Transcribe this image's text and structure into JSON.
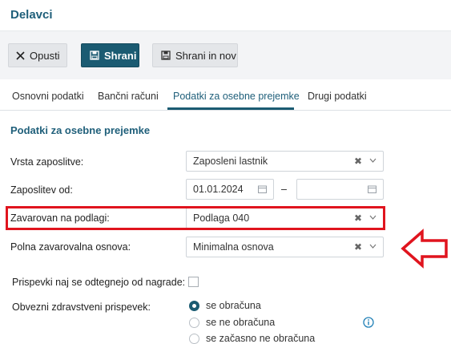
{
  "header": {
    "title": "Delavci"
  },
  "toolbar": {
    "cancel_label": "Opusti",
    "save_label": "Shrani",
    "save_new_label": "Shrani in nov"
  },
  "tabs": [
    {
      "label": "Osnovni podatki"
    },
    {
      "label": "Bančni računi"
    },
    {
      "label": "Podatki za osebne prejemke"
    },
    {
      "label": "Drugi podatki"
    }
  ],
  "section": {
    "title": "Podatki za osebne prejemke"
  },
  "form": {
    "employment_type": {
      "label": "Vrsta zaposlitve:",
      "value": "Zaposleni lastnik"
    },
    "employment_from": {
      "label": "Zaposlitev od:",
      "from": "01.01.2024",
      "separator": "–",
      "to": ""
    },
    "insured_basis": {
      "label": "Zavarovan na podlagi:",
      "value": "Podlaga 040"
    },
    "full_insurance_basis": {
      "label": "Polna zavarovalna osnova:",
      "value": "Minimalna osnova"
    },
    "deduct_contributions": {
      "label": "Prispevki naj se odtegnejo od nagrade:",
      "checked": false
    },
    "health_contribution": {
      "label": "Obvezni zdravstveni prispevek:",
      "options": [
        {
          "label": "se obračuna",
          "selected": true
        },
        {
          "label": "se ne obračuna",
          "selected": false
        },
        {
          "label": "se začasno ne obračuna",
          "selected": false
        }
      ]
    }
  },
  "colors": {
    "brand": "#1b5b72",
    "highlight": "#e0141e"
  }
}
